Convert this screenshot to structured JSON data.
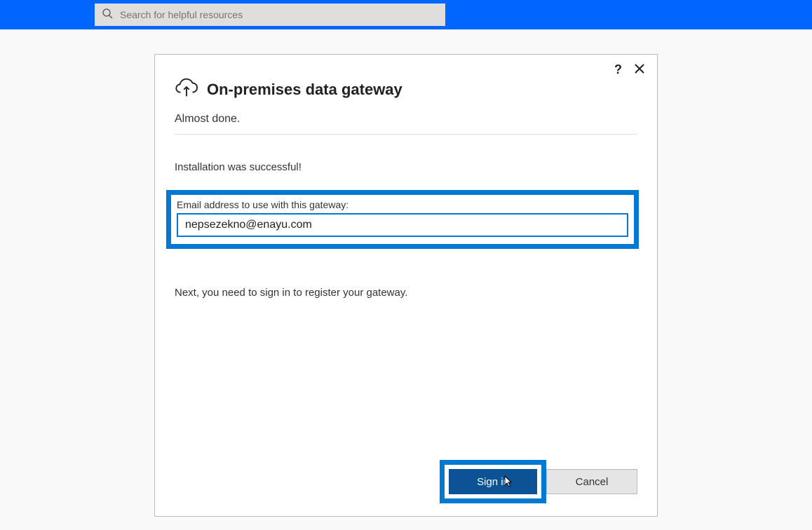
{
  "topbar": {
    "search_placeholder": "Search for helpful resources"
  },
  "dialog": {
    "title": "On-premises data gateway",
    "subtitle": "Almost done.",
    "status": "Installation was successful!",
    "email_label": "Email address to use with this gateway:",
    "email_value": "nepsezekno@enayu.com",
    "next_step": "Next, you need to sign in to register your gateway.",
    "buttons": {
      "primary": "Sign in",
      "secondary": "Cancel"
    }
  }
}
